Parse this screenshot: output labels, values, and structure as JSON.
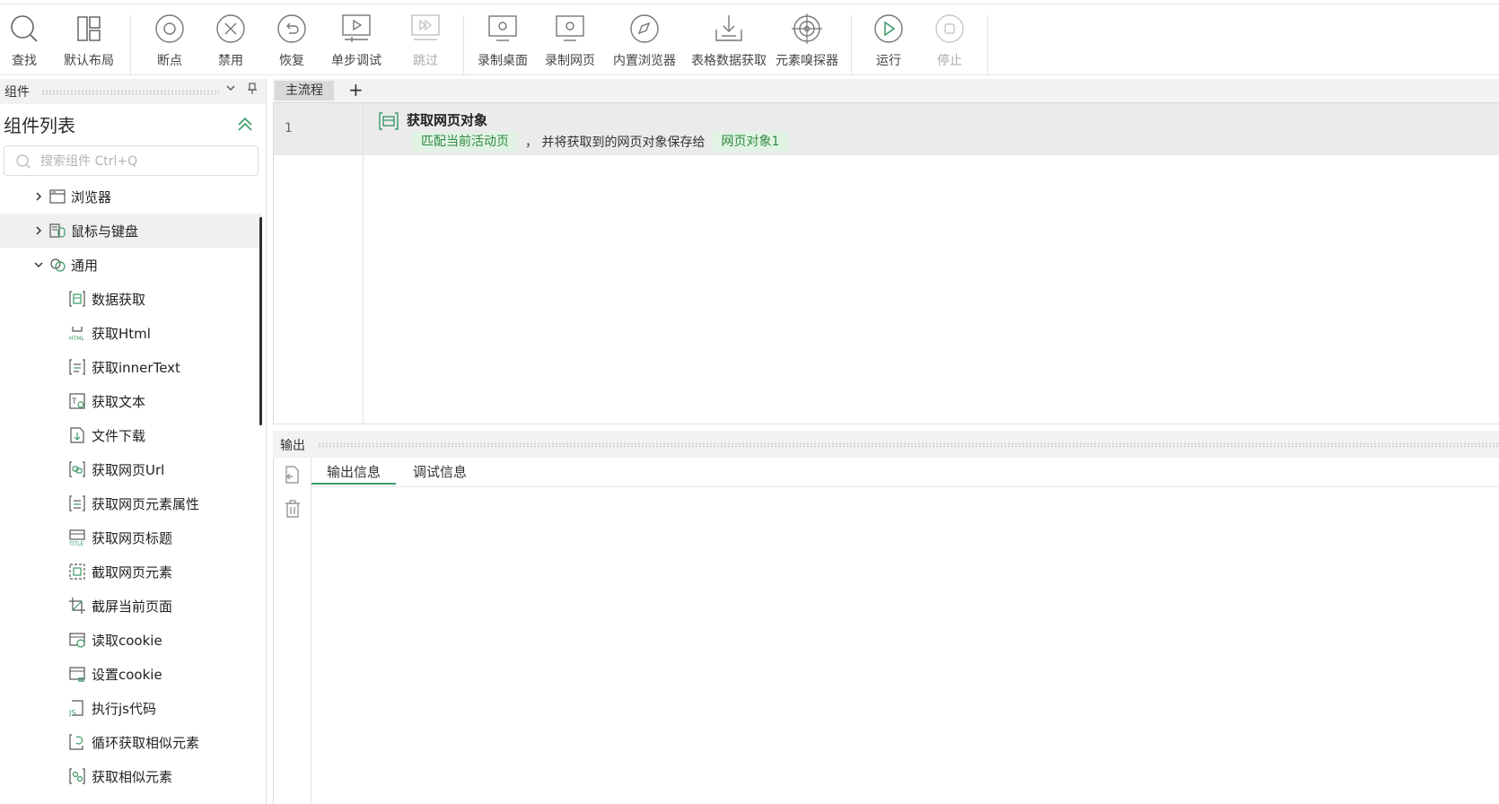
{
  "toolbar": {
    "find": "查找",
    "default_layout": "默认布局",
    "breakpoint": "断点",
    "disable": "禁用",
    "restore": "恢复",
    "step_debug": "单步调试",
    "skip": "跳过",
    "record_desktop": "录制桌面",
    "record_web": "录制网页",
    "builtin_browser": "内置浏览器",
    "table_data_fetch": "表格数据获取",
    "element_sniffer": "元素嗅探器",
    "run": "运行",
    "stop": "停止"
  },
  "left_panel": {
    "header": "组件",
    "title": "组件列表",
    "search_placeholder": "搜索组件 Ctrl+Q",
    "categories": [
      {
        "label": "浏览器",
        "expanded": false
      },
      {
        "label": "鼠标与键盘",
        "expanded": false
      },
      {
        "label": "通用",
        "expanded": true
      }
    ],
    "items": [
      "数据获取",
      "获取Html",
      "获取innerText",
      "获取文本",
      "文件下载",
      "获取网页Url",
      "获取网页元素属性",
      "获取网页标题",
      "截取网页元素",
      "截屏当前页面",
      "读取cookie",
      "设置cookie",
      "执行js代码",
      "循环获取相似元素",
      "获取相似元素"
    ]
  },
  "editor": {
    "tab": "主流程",
    "add_tab": "+",
    "line_number": "1",
    "step_title": "获取网页对象",
    "chip_match": "匹配当前活动页",
    "desc_text": "， 并将获取到的网页对象保存给",
    "chip_var": "网页对象1"
  },
  "output": {
    "header": "输出",
    "tabs": [
      "输出信息",
      "调试信息"
    ],
    "active_tab": 0
  },
  "colors": {
    "accent_green": "#3a9a66",
    "chip_bg": "#e1f3e5",
    "chip_text": "#2f8a3d"
  }
}
